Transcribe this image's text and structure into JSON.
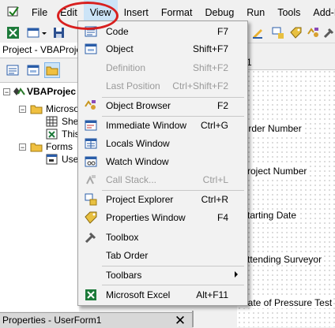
{
  "menubar": {
    "items": [
      {
        "label": "File"
      },
      {
        "label": "Edit"
      },
      {
        "label": "View"
      },
      {
        "label": "Insert"
      },
      {
        "label": "Format"
      },
      {
        "label": "Debug"
      },
      {
        "label": "Run"
      },
      {
        "label": "Tools"
      },
      {
        "label": "Add-Ins"
      }
    ]
  },
  "project": {
    "title": "Project - VBAProje",
    "tree": [
      {
        "label": "VBAProjec"
      },
      {
        "label": "Microsof"
      },
      {
        "label": "Shee"
      },
      {
        "label": "This"
      },
      {
        "label": "Forms"
      },
      {
        "label": "User"
      }
    ]
  },
  "properties": {
    "title": "Properties - UserForm1",
    "close": "✕"
  },
  "form": {
    "tab": "1",
    "labels": [
      "Order Number",
      "Project Number",
      "Starting Date",
      "Attending Surveyor",
      "Date of Pressure Test"
    ]
  },
  "view_menu": {
    "items": [
      {
        "label": "Code",
        "shortcut": "F7",
        "icon": "code-icon"
      },
      {
        "label": "Object",
        "shortcut": "Shift+F7",
        "icon": "object-icon"
      },
      {
        "label": "Definition",
        "shortcut": "Shift+F2"
      },
      {
        "label": "Last Position",
        "shortcut": "Ctrl+Shift+F2"
      },
      {
        "label": "Object Browser",
        "shortcut": "F2",
        "icon": "object-browser-icon"
      },
      {
        "label": "Immediate Window",
        "shortcut": "Ctrl+G",
        "icon": "immediate-window-icon"
      },
      {
        "label": "Locals Window",
        "shortcut": "",
        "icon": "locals-window-icon"
      },
      {
        "label": "Watch Window",
        "shortcut": "",
        "icon": "watch-window-icon"
      },
      {
        "label": "Call Stack...",
        "shortcut": "Ctrl+L",
        "icon": "call-stack-icon"
      },
      {
        "label": "Project Explorer",
        "shortcut": "Ctrl+R",
        "icon": "project-explorer-icon"
      },
      {
        "label": "Properties Window",
        "shortcut": "F4",
        "icon": "properties-window-icon"
      },
      {
        "label": "Toolbox",
        "shortcut": "",
        "icon": "toolbox-icon"
      },
      {
        "label": "Tab Order",
        "shortcut": ""
      },
      {
        "label": "Toolbars",
        "shortcut": ""
      },
      {
        "label": "Microsoft Excel",
        "shortcut": "Alt+F11",
        "icon": "excel-icon"
      }
    ]
  }
}
